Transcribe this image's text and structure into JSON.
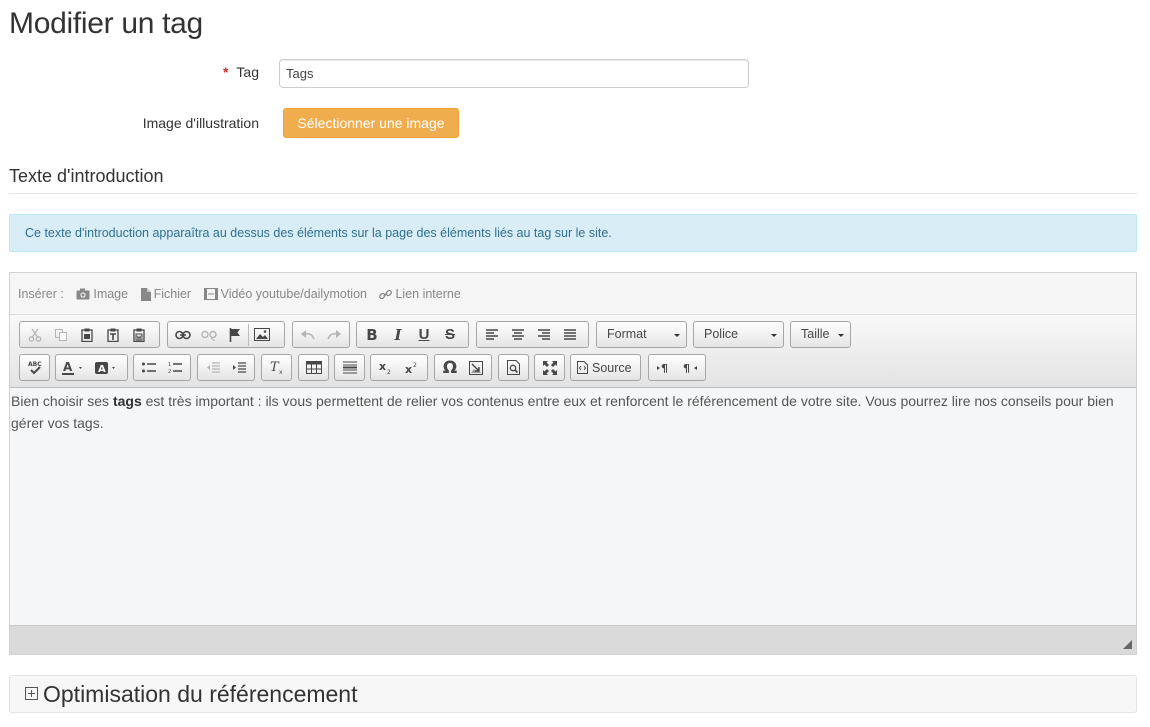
{
  "page": {
    "title": "Modifier un tag"
  },
  "form": {
    "tag_label": "Tag",
    "required_mark": "*",
    "tag_value": "Tags",
    "image_label": "Image d'illustration",
    "select_image_button": "Sélectionner une image"
  },
  "intro": {
    "section_title": "Texte d'introduction",
    "info_text": "Ce texte d'introduction apparaîtra au dessus des éléments sur la page des éléments liés au tag sur le site."
  },
  "editor": {
    "insert_label": "Insérer :",
    "insert_items": [
      {
        "label": "Image",
        "icon": "camera-icon"
      },
      {
        "label": "Fichier",
        "icon": "file-icon"
      },
      {
        "label": "Vidéo youtube/dailymotion",
        "icon": "film-icon"
      },
      {
        "label": "Lien interne",
        "icon": "link-icon"
      }
    ],
    "combos": {
      "format": "Format",
      "font": "Police",
      "size": "Taille"
    },
    "source_label": "Source",
    "content": {
      "before": "Bien choisir ses ",
      "bold": "tags",
      "after": " est très important : ils vous permettent de relier vos contenus entre eux et renforcent le référencement de votre site. Vous pourrez lire nos conseils pour bien gérer vos tags."
    }
  },
  "seo_panel": {
    "title": "Optimisation du référencement"
  },
  "colors": {
    "warning": "#f0ad4e",
    "info_bg": "#d9edf7",
    "info_text": "#31708f",
    "required": "#c9302c"
  }
}
